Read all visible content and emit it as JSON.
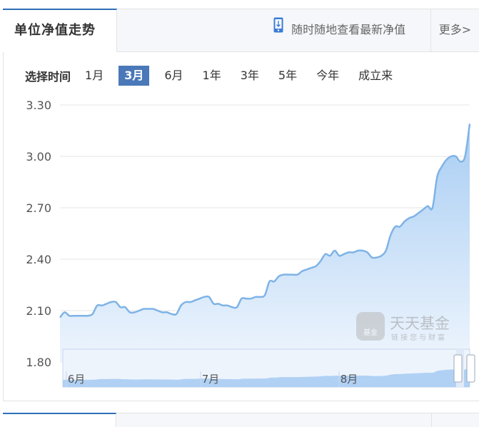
{
  "header": {
    "tab_title": "单位净值走势",
    "mobile_link": "随时随地查看最新净值",
    "more_label": "更多>"
  },
  "range": {
    "label": "选择时间",
    "options": [
      "1月",
      "3月",
      "6月",
      "1年",
      "3年",
      "5年",
      "今年",
      "成立来"
    ],
    "selected": "3月"
  },
  "watermark": {
    "icon_text": "基金",
    "name": "天天基金",
    "slogan": "链接您与财富"
  },
  "colors": {
    "line": "#7eb3e6",
    "area_top": "#a8cdf3",
    "area_bottom": "#eef5fd",
    "active_tab": "#4a78b8",
    "accent": "#2f6fb7"
  },
  "chart_data": {
    "type": "area",
    "y_ticks": [
      "3.30",
      "3.00",
      "2.70",
      "2.40",
      "2.10",
      "1.80"
    ],
    "ylim": [
      1.8,
      3.3
    ],
    "navigator_labels": [
      "6月",
      "7月",
      "8月"
    ],
    "values": [
      2.06,
      2.09,
      2.07,
      2.07,
      2.07,
      2.07,
      2.07,
      2.08,
      2.13,
      2.13,
      2.14,
      2.15,
      2.15,
      2.12,
      2.12,
      2.09,
      2.09,
      2.1,
      2.11,
      2.11,
      2.11,
      2.1,
      2.09,
      2.09,
      2.08,
      2.08,
      2.13,
      2.15,
      2.15,
      2.16,
      2.17,
      2.18,
      2.18,
      2.14,
      2.14,
      2.13,
      2.13,
      2.12,
      2.12,
      2.17,
      2.17,
      2.17,
      2.18,
      2.18,
      2.19,
      2.27,
      2.27,
      2.3,
      2.31,
      2.31,
      2.31,
      2.31,
      2.33,
      2.34,
      2.35,
      2.36,
      2.39,
      2.43,
      2.42,
      2.45,
      2.42,
      2.43,
      2.44,
      2.44,
      2.45,
      2.45,
      2.44,
      2.41,
      2.41,
      2.42,
      2.45,
      2.54,
      2.59,
      2.59,
      2.62,
      2.64,
      2.65,
      2.67,
      2.69,
      2.71,
      2.7,
      2.88,
      2.94,
      2.98,
      3.0,
      3.0,
      2.97,
      3.0,
      3.19
    ]
  }
}
